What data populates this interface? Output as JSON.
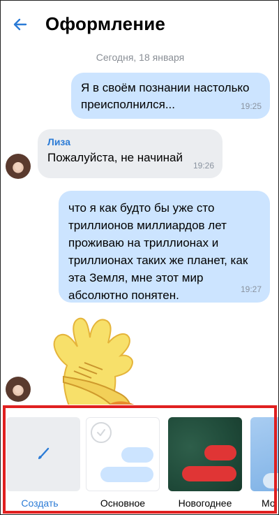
{
  "header": {
    "title": "Оформление"
  },
  "chat": {
    "date_divider": "Сегодня, 18 января",
    "messages": [
      {
        "direction": "out",
        "text": "Я в своём познании настолько преисполнился...",
        "time": "19:25"
      },
      {
        "direction": "in",
        "sender": "Лиза",
        "text": "Пожалуйста, не начинай",
        "time": "19:26"
      },
      {
        "direction": "out",
        "text": "что я как будто бы уже сто триллионов миллиардов лет проживаю на триллионах и триллионах таких же планет, как эта Земля, мне этот мир абсолютно понятен.",
        "time": "19:27"
      },
      {
        "direction": "in",
        "type": "sticker",
        "sticker": "dabbing-yellow-hand-sticker"
      }
    ]
  },
  "themes": {
    "items": [
      {
        "label": "Создать",
        "icon": "paintbrush-icon",
        "selected": false
      },
      {
        "label": "Основное",
        "selected": true
      },
      {
        "label": "Новогоднее",
        "selected": false
      },
      {
        "label": "Мо",
        "selected": false
      }
    ]
  },
  "colors": {
    "accent": "#2b7bd6",
    "outgoing_bubble": "#cce4ff",
    "incoming_bubble": "#ebedf0",
    "highlight_border": "#e02020",
    "newyear_bg": "#1f4a39",
    "newyear_pill": "#e03535"
  }
}
